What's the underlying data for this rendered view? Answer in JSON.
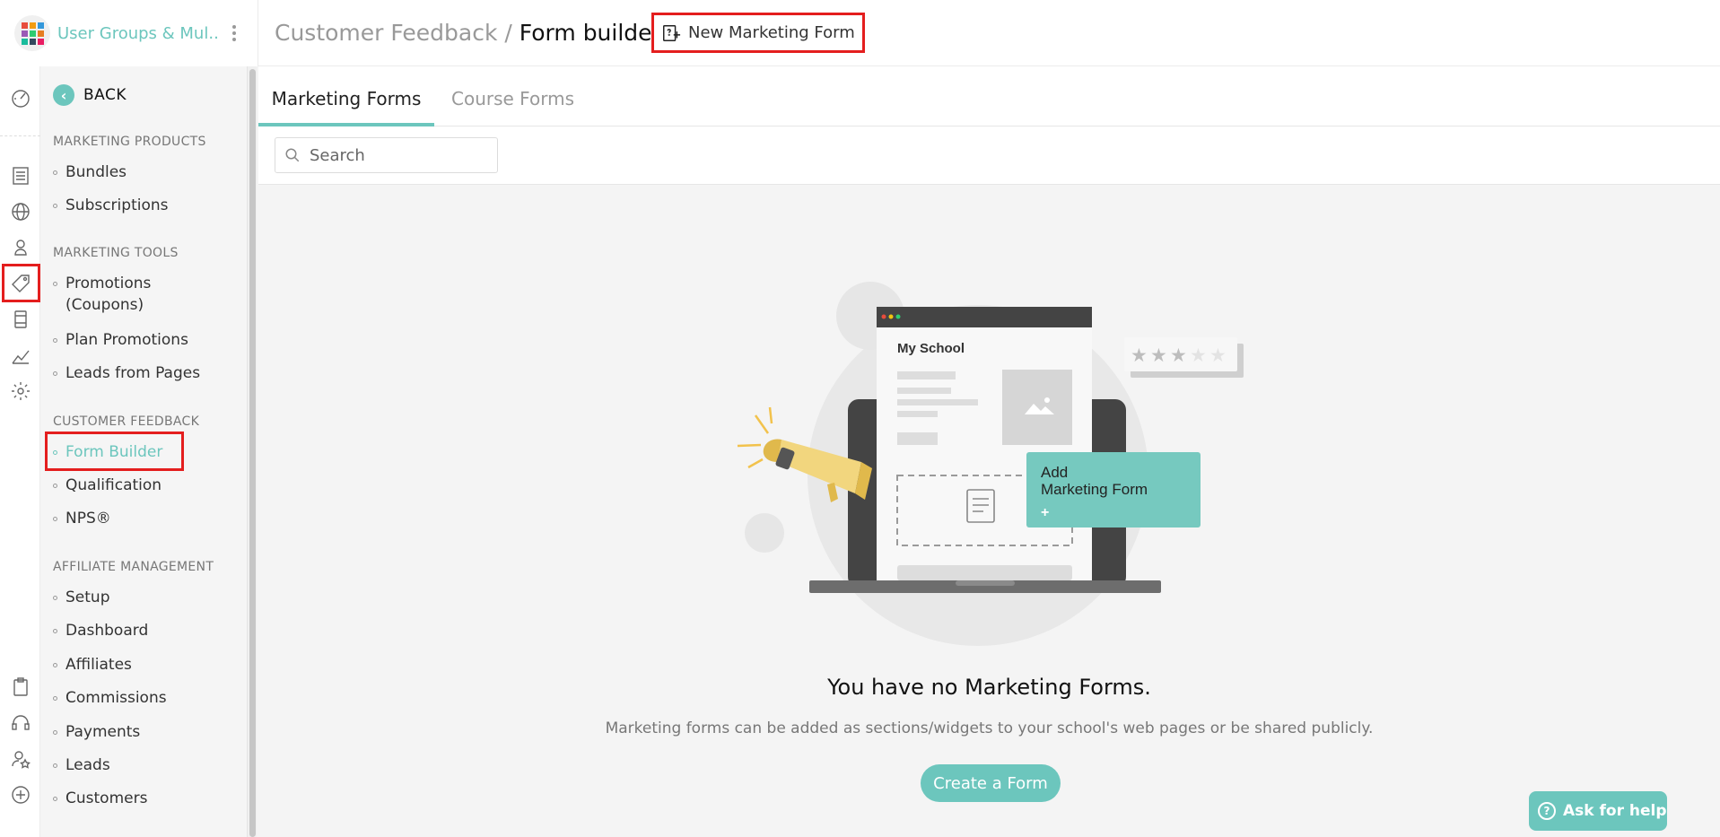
{
  "brand": {
    "name": "User Groups & Mul...",
    "colors": [
      "#e74c3c",
      "#f39c12",
      "#3498db",
      "#9b59b6",
      "#2ecc71",
      "#e67e22",
      "#1abc9c",
      "#34495e",
      "#e91e63"
    ]
  },
  "rail": {
    "top_icons": [
      "dashboard-icon",
      "pages-icon",
      "globe-icon",
      "users-icon",
      "marketing-tag-icon",
      "mobile-icon",
      "analytics-icon",
      "settings-icon"
    ],
    "bottom_icons": [
      "clipboard-icon",
      "support-headset-icon",
      "user-star-icon",
      "add-circle-icon"
    ]
  },
  "menu": {
    "back_label": "BACK",
    "sections": [
      {
        "title": "MARKETING PRODUCTS",
        "items": [
          "Bundles",
          "Subscriptions"
        ]
      },
      {
        "title": "MARKETING TOOLS",
        "items": [
          "Promotions (Coupons)",
          "Plan Promotions",
          "Leads from Pages"
        ]
      },
      {
        "title": "CUSTOMER FEEDBACK",
        "items": [
          "Form Builder",
          "Qualification",
          "NPS®"
        ]
      },
      {
        "title": "AFFILIATE MANAGEMENT",
        "items": [
          "Setup",
          "Dashboard",
          "Affiliates",
          "Commissions",
          "Payments",
          "Leads",
          "Customers"
        ]
      }
    ],
    "active_item": "Form Builder"
  },
  "header": {
    "breadcrumb_parent": "Customer Feedback /",
    "breadcrumb_current": "Form builder",
    "new_form_label": "New Marketing Form"
  },
  "tabs": [
    {
      "label": "Marketing Forms",
      "active": true
    },
    {
      "label": "Course Forms",
      "active": false
    }
  ],
  "search": {
    "placeholder": "Search",
    "value": ""
  },
  "illustration": {
    "school_name": "My School",
    "add_card_line1": "Add",
    "add_card_line2": "Marketing Form",
    "add_card_plus": "+",
    "rating_stars": 3,
    "rating_max": 5
  },
  "empty_state": {
    "title": "You have no Marketing Forms.",
    "description": "Marketing forms can be added as sections/widgets to your school's web pages or be shared publicly.",
    "create_label": "Create a Form"
  },
  "help": {
    "label": "Ask for help",
    "icon": "question-circle-icon"
  },
  "colors": {
    "accent": "#6cc6bd",
    "highlight": "#e41e1e",
    "dark": "#444444"
  }
}
